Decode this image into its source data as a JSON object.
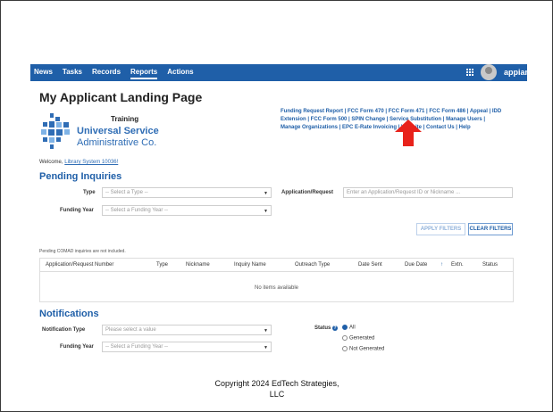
{
  "nav": {
    "items": [
      "News",
      "Tasks",
      "Records",
      "Reports",
      "Actions"
    ],
    "active": "Reports",
    "brand": "appian",
    "grid_icon": "apps-grid-icon",
    "avatar_icon": "user-avatar"
  },
  "page": {
    "title": "My Applicant Landing Page",
    "logo": {
      "training": "Training",
      "line1": "Universal Service",
      "line2": "Administrative Co."
    },
    "welcome_prefix": "Welcome,",
    "welcome_user": "Library System 10036!"
  },
  "quick_links": [
    "Funding Request Report",
    "FCC Form 470",
    "FCC Form 471",
    "FCC Form 486",
    "Appeal",
    "IDD Extension",
    "FCC Form 500",
    "SPIN Change",
    "Service Substitution",
    "Manage Users",
    "Manage Organizations",
    "EPC E-Rate Invoicing",
    "Website",
    "Contact Us",
    "Help"
  ],
  "quick_links_text": {
    "row1": "Funding Request Report | FCC Form 470 | FCC Form 471 | FCC Form 486 | Appeal | IDD",
    "row2": "Extension | FCC Form 500 | SPIN Change | Service Substitution | Manage Users |",
    "row3": "Manage Organizations | EPC E-Rate Invoicing | Website | Contact Us | Help"
  },
  "pending": {
    "heading": "Pending Inquiries",
    "type_label": "Type",
    "type_placeholder": "-- Select a Type --",
    "funding_year_label": "Funding Year",
    "funding_year_placeholder": "-- Select a Funding Year --",
    "app_request_label": "Application/Request",
    "app_request_placeholder": "Enter an Application/Request ID or Nickname ...",
    "apply_filters": "APPLY FILTERS",
    "clear_filters": "CLEAR FILTERS",
    "note": "Pending COMAD inquiries are not included.",
    "columns": [
      "Application/Request Number",
      "Type",
      "Nickname",
      "Inquiry Name",
      "Outreach Type",
      "Date Sent",
      "Due Date",
      "↑",
      "Extn.",
      "Status"
    ],
    "empty_message": "No items available"
  },
  "notifications": {
    "heading": "Notifications",
    "type_label": "Notification Type",
    "type_placeholder": "Please select a value",
    "funding_year_label": "Funding Year",
    "funding_year_placeholder": "-- Select a Funding Year --",
    "status_label": "Status",
    "status_options": [
      "All",
      "Generated",
      "Not Generated"
    ],
    "status_selected": "All"
  },
  "footer": {
    "copyright_line1": "Copyright 2024 EdTech Strategies,",
    "copyright_line2": "LLC"
  },
  "colors": {
    "nav_bg": "#1f5fa8",
    "accent": "#2f6db5",
    "arrow": "#e8221b"
  }
}
